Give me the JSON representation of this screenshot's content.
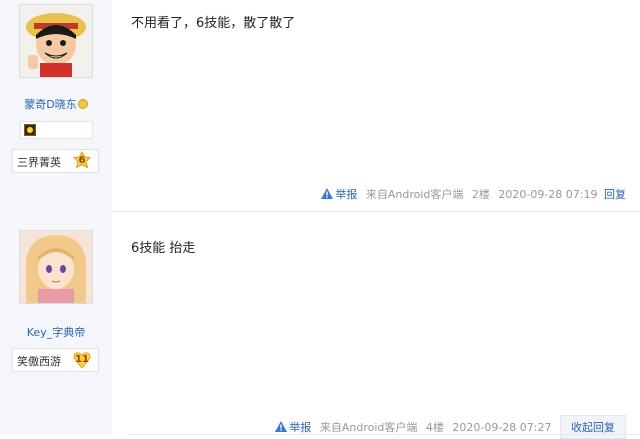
{
  "posts": [
    {
      "username": "蒙奇D晓东",
      "level_name": "三界菁英",
      "level": "6",
      "content": "不用看了，6技能，散了散了",
      "report": "举报",
      "source": "来自Android客户端",
      "floor": "2楼",
      "time": "2020-09-28 07:19",
      "reply": "回复"
    },
    {
      "username": "Key_字典帝",
      "level_name": "笑傲西游",
      "level": "11",
      "content": "6技能 抬走",
      "report": "举报",
      "source": "来自Android客户端",
      "floor": "4楼",
      "time": "2020-09-28 07:27",
      "reply": "收起回复"
    }
  ],
  "colors": {
    "link": "#2d64b3",
    "sidebar_bg": "#f4f6f9",
    "meta": "#999999"
  }
}
